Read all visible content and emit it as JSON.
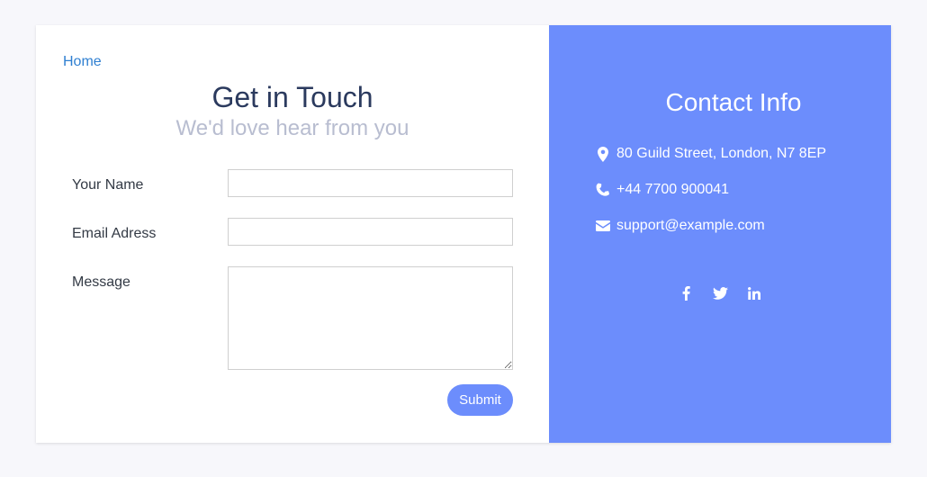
{
  "nav": {
    "home_label": "Home"
  },
  "form": {
    "title": "Get in Touch",
    "subtitle": "We'd love hear from you",
    "name_label": "Your Name",
    "name_value": "",
    "email_label": "Email Adress",
    "email_value": "",
    "message_label": "Message",
    "message_value": "",
    "submit_label": "Submit"
  },
  "contact": {
    "title": "Contact Info",
    "address": "80 Guild Street, London, N7 8EP",
    "phone": "+44 7700 900041",
    "email": "support@example.com",
    "socials": [
      "facebook-icon",
      "twitter-icon",
      "linkedin-icon"
    ]
  },
  "colors": {
    "accent": "#6c8dfc",
    "title": "#2b3a5e",
    "subtitle": "#b8bdd0",
    "link": "#2f7fd1",
    "page_bg": "#f7f7fb"
  }
}
